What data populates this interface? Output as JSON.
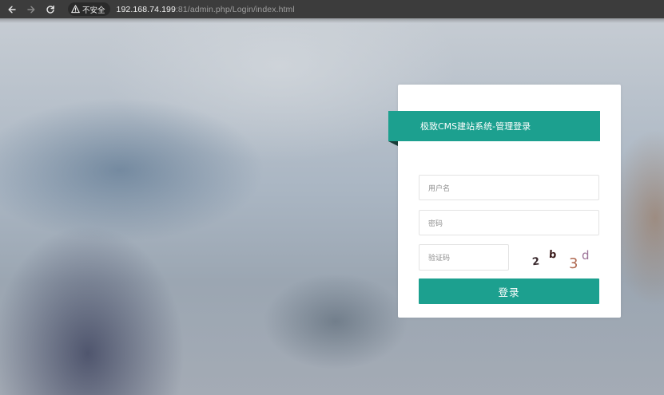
{
  "browser": {
    "security_label": "不安全",
    "url_host": "192.168.74.199",
    "url_rest": ":81/admin.php/Login/index.html"
  },
  "login": {
    "title": "极致CMS建站系统-管理登录",
    "username_placeholder": "用户名",
    "password_placeholder": "密码",
    "captcha_placeholder": "验证码",
    "captcha_chars": [
      "2",
      "b",
      "3",
      "d"
    ],
    "submit_label": "登录"
  },
  "colors": {
    "accent": "#1ca08f",
    "toolbar": "#3c3c3c"
  }
}
